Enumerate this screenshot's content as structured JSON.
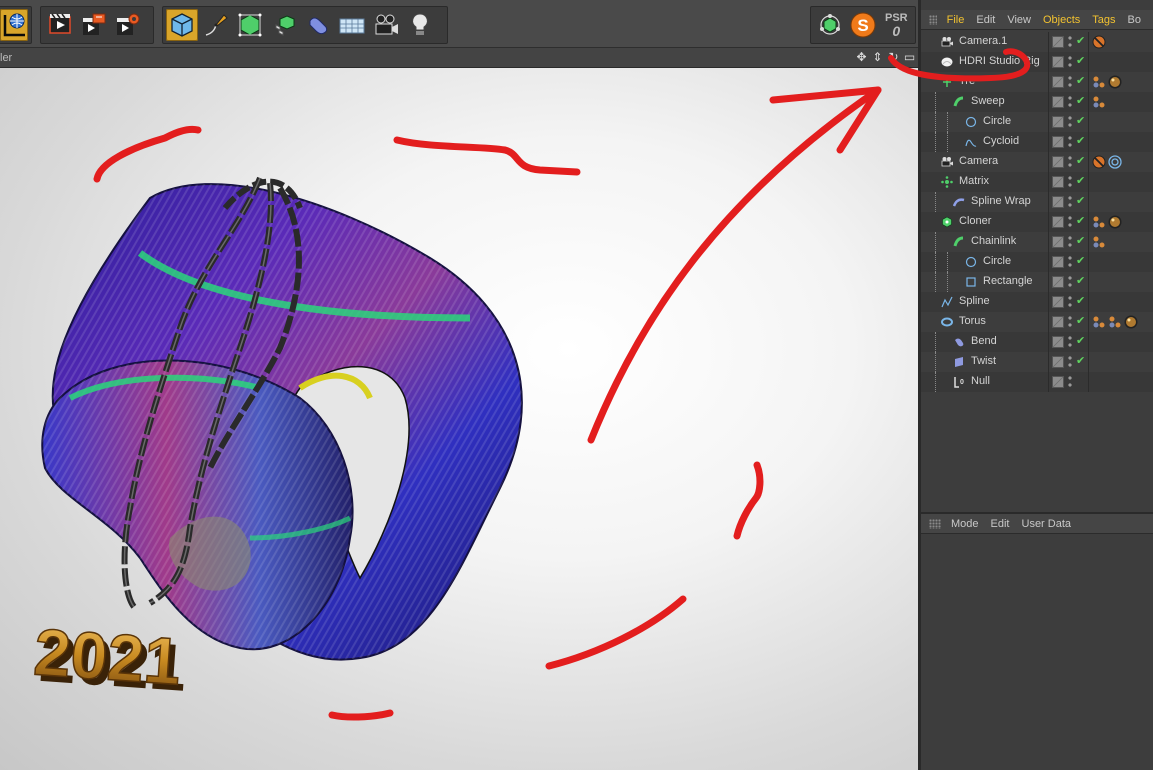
{
  "viewport": {
    "menu_label": "ler"
  },
  "toolbar": {
    "left_icons": [
      "coordinate-system-icon",
      "render-active-view-icon",
      "render-to-picture-viewer-icon",
      "edit-render-settings-icon"
    ],
    "mid_icons": [
      "cube-icon",
      "pen-icon",
      "subdivision-icon",
      "array-icon",
      "deformer-icon",
      "floor-icon",
      "camera-icon",
      "light-icon"
    ],
    "right_icons": [
      "mograph-icon",
      "substance-icon",
      "psr-icon"
    ],
    "psr_text": "PSR",
    "psr_value": "0"
  },
  "objects_menu": {
    "items": [
      "File",
      "Edit",
      "View",
      "Objects",
      "Tags",
      "Bo"
    ]
  },
  "attributes_menu": {
    "items": [
      "Mode",
      "Edit",
      "User Data"
    ]
  },
  "objects": [
    {
      "name": "Camera.1",
      "depth": 0,
      "icon": "camera-icon",
      "tags": [
        "protection-tag"
      ]
    },
    {
      "name": "HDRI Studio Rig",
      "depth": 0,
      "icon": "hdri-icon",
      "tags": []
    },
    {
      "name": "Tre",
      "depth": 0,
      "icon": "tree-icon",
      "tags": [
        "material-tag",
        "material-ball-tag"
      ]
    },
    {
      "name": "Sweep",
      "depth": 1,
      "icon": "sweep-icon",
      "tags": [
        "material-tag"
      ]
    },
    {
      "name": "Circle",
      "depth": 2,
      "icon": "circle-spline-icon",
      "tags": []
    },
    {
      "name": "Cycloid",
      "depth": 2,
      "icon": "cycloid-spline-icon",
      "tags": []
    },
    {
      "name": "Camera",
      "depth": 0,
      "icon": "camera-icon",
      "tags": [
        "protection-tag",
        "target-tag"
      ]
    },
    {
      "name": "Matrix",
      "depth": 0,
      "icon": "matrix-icon",
      "tags": []
    },
    {
      "name": "Spline Wrap",
      "depth": 1,
      "icon": "spline-wrap-icon",
      "tags": []
    },
    {
      "name": "Cloner",
      "depth": 0,
      "icon": "cloner-icon",
      "tags": [
        "material-tag",
        "material-ball-tag"
      ]
    },
    {
      "name": "Chainlink",
      "depth": 1,
      "icon": "sweep-icon",
      "tags": [
        "material-tag"
      ]
    },
    {
      "name": "Circle",
      "depth": 2,
      "icon": "circle-spline-icon",
      "tags": []
    },
    {
      "name": "Rectangle",
      "depth": 2,
      "icon": "rectangle-spline-icon",
      "tags": []
    },
    {
      "name": "Spline",
      "depth": 0,
      "icon": "spline-icon",
      "tags": []
    },
    {
      "name": "Torus",
      "depth": 0,
      "icon": "torus-icon",
      "tags": [
        "material-tag",
        "material-tag",
        "material-ball-tag"
      ]
    },
    {
      "name": "Bend",
      "depth": 1,
      "icon": "bend-icon",
      "tags": []
    },
    {
      "name": "Twist",
      "depth": 1,
      "icon": "twist-icon",
      "tags": []
    },
    {
      "name": "Null",
      "depth": 1,
      "icon": "null-icon",
      "tags": []
    }
  ],
  "scene": {
    "pendant_text": "2021"
  },
  "colors": {
    "highlight_menu": "#f2c230",
    "annotation_red": "#e31e1e",
    "check_green": "#5fd45f"
  }
}
